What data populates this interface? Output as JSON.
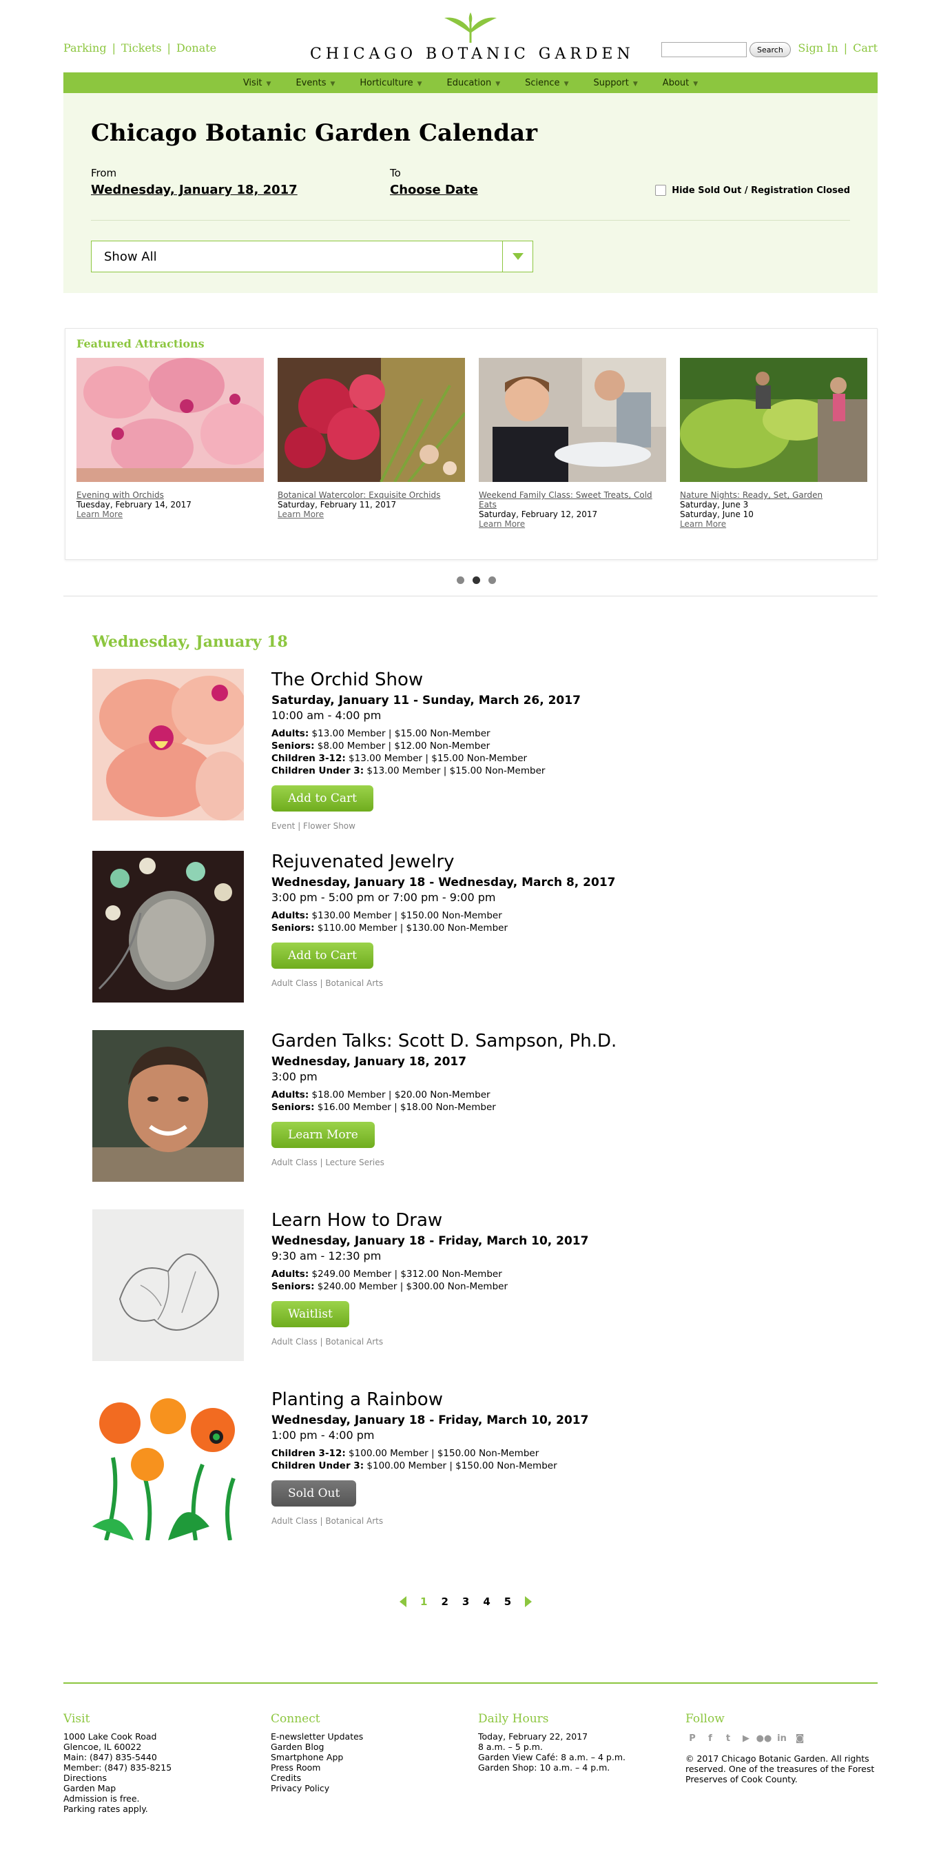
{
  "utility_nav": [
    "Parking",
    "Tickets",
    "Donate"
  ],
  "logo": {
    "text": "CHICAGO BOTANIC GARDEN",
    "color": "#8cc63f"
  },
  "search": {
    "placeholder": "",
    "button": "Search"
  },
  "account": {
    "sign_in": "Sign In",
    "cart": "Cart"
  },
  "main_nav": [
    "Visit",
    "Events",
    "Horticulture",
    "Education",
    "Science",
    "Support",
    "About"
  ],
  "calendar": {
    "title": "Chicago Botanic Garden Calendar",
    "from_label": "From",
    "from_value": "Wednesday, January 18, 2017",
    "to_label": "To",
    "to_value": "Choose Date",
    "hide_sold_label": "Hide Sold Out / Registration Closed",
    "filter_value": "Show All"
  },
  "featured": {
    "heading": "Featured Attractions",
    "items": [
      {
        "title": "Evening with Orchids",
        "date": "Tuesday, February 14, 2017",
        "link": "Learn More",
        "image": "pink-orchids"
      },
      {
        "title": "Botanical Watercolor: Exquisite Orchids",
        "date": "Saturday, February 11, 2017",
        "link": "Learn More",
        "image": "red-orchids"
      },
      {
        "title": "Weekend Family Class: Sweet Treats, Cold Eats",
        "date": "Saturday, February 12, 2017",
        "link": "Learn More",
        "image": "boy-eating"
      },
      {
        "title": "Nature Nights: Ready, Set, Garden",
        "date": "Saturday, June 3",
        "date2": "Saturday, June 10",
        "link": "Learn More",
        "image": "garden-beds"
      }
    ]
  },
  "day_heading": "Wednesday, January 18",
  "events": [
    {
      "name": "The Orchid Show",
      "dates": "Saturday, January 11 - Sunday, March 26, 2017",
      "time": "10:00 am - 4:00 pm",
      "prices": [
        {
          "label": "Adults:",
          "value": "$13.00 Member | $15.00 Non-Member"
        },
        {
          "label": "Seniors:",
          "value": "$8.00 Member | $12.00 Non-Member"
        },
        {
          "label": "Children 3-12:",
          "value": "$13.00 Member | $15.00 Non-Member"
        },
        {
          "label": "Children Under 3:",
          "value": "$13.00 Member | $15.00 Non-Member"
        }
      ],
      "cta": "Add to Cart",
      "tags": "Event | Flower Show",
      "image": "orchid"
    },
    {
      "name": "Rejuvenated Jewelry",
      "dates": "Wednesday, January 18 - Wednesday, March 8, 2017",
      "time": "3:00 pm - 5:00 pm or 7:00 pm - 9:00 pm",
      "prices": [
        {
          "label": "Adults:",
          "value": "$130.00 Member | $150.00 Non-Member"
        },
        {
          "label": "Seniors:",
          "value": "$110.00 Member | $130.00 Non-Member"
        }
      ],
      "cta": "Add to Cart",
      "tags": "Adult Class | Botanical Arts",
      "image": "jewelry"
    },
    {
      "name": "Garden Talks: Scott D. Sampson, Ph.D.",
      "dates": "Wednesday, January 18, 2017",
      "time": "3:00 pm",
      "prices": [
        {
          "label": "Adults:",
          "value": "$18.00 Member | $20.00 Non-Member"
        },
        {
          "label": "Seniors:",
          "value": "$16.00 Member | $18.00 Non-Member"
        }
      ],
      "cta": "Learn More",
      "tags": "Adult Class | Lecture Series",
      "image": "portrait"
    },
    {
      "name": "Learn How to Draw",
      "dates": "Wednesday, January 18 - Friday, March 10, 2017",
      "time": "9:30 am - 12:30 pm",
      "prices": [
        {
          "label": "Adults:",
          "value": "$249.00 Member | $312.00 Non-Member"
        },
        {
          "label": "Seniors:",
          "value": "$240.00 Member | $300.00 Non-Member"
        }
      ],
      "cta": "Waitlist",
      "tags": "Adult Class | Botanical Arts",
      "image": "sketch"
    },
    {
      "name": "Planting a Rainbow",
      "dates": "Wednesday, January 18 - Friday, March 10, 2017",
      "time": "1:00 pm - 4:00 pm",
      "prices": [
        {
          "label": "Children 3-12:",
          "value": "$100.00 Member | $150.00 Non-Member"
        },
        {
          "label": "Children Under 3:",
          "value": "$100.00 Member | $150.00 Non-Member"
        }
      ],
      "cta": "Sold Out",
      "cta_state": "sold-out",
      "tags": "Adult Class | Botanical Arts",
      "image": "flowers-illustration"
    }
  ],
  "pagination": {
    "pages": [
      "1",
      "2",
      "3",
      "4",
      "5"
    ],
    "current": "1"
  },
  "footer": {
    "visit": {
      "heading": "Visit",
      "lines": [
        "1000 Lake Cook Road",
        "Glencoe, IL 60022",
        "Main: (847) 835-5440",
        "Member: (847) 835-8215",
        "Directions",
        "Garden Map",
        "Admission is free.",
        "Parking rates apply."
      ]
    },
    "connect": {
      "heading": "Connect",
      "lines": [
        "E-newsletter Updates",
        "Garden Blog",
        "Smartphone App",
        "Press Room",
        "Credits",
        "Privacy Policy"
      ]
    },
    "hours": {
      "heading": "Daily Hours",
      "lines": [
        "Today, February 22, 2017",
        "8 a.m. – 5 p.m.",
        "Garden View Café: 8 a.m. – 4 p.m.",
        "Garden Shop: 10 a.m. – 4 p.m."
      ]
    },
    "follow": {
      "heading": "Follow",
      "icons": [
        "pinterest-icon",
        "facebook-icon",
        "twitter-icon",
        "youtube-icon",
        "flickr-icon",
        "linkedin-icon",
        "instagram-icon"
      ],
      "copyright": "© 2017 Chicago Botanic Garden. All rights reserved. One of the treasures of the Forest Preserves of Cook County."
    }
  }
}
